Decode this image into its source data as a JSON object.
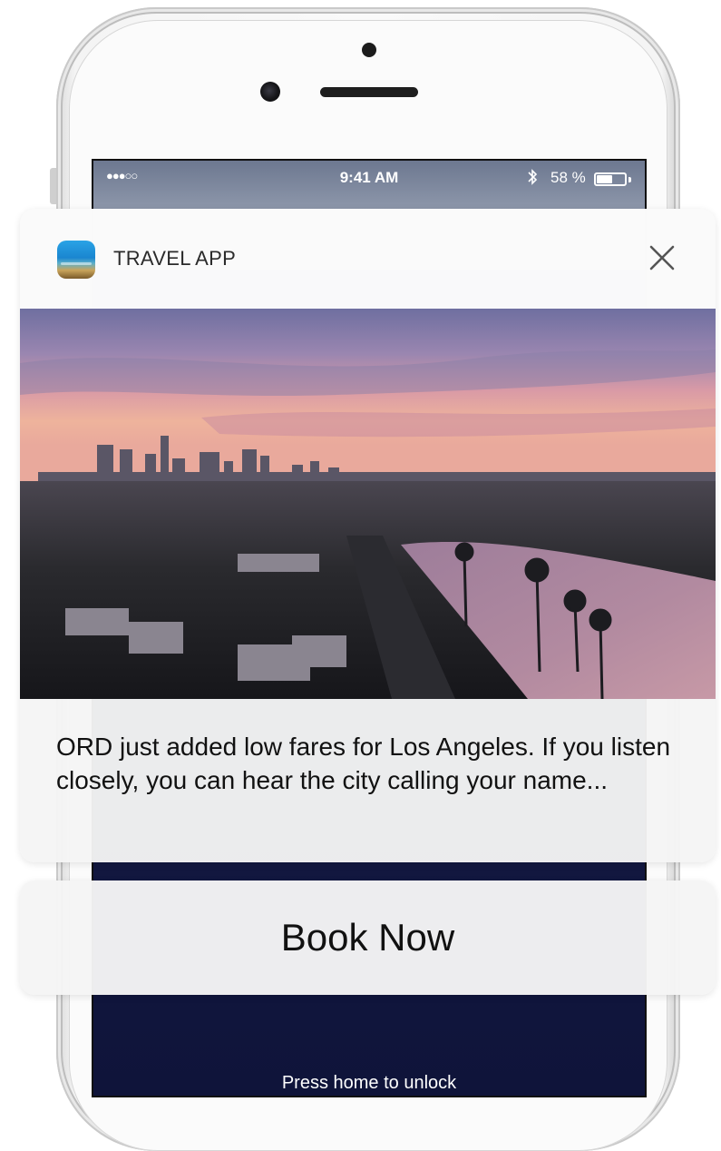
{
  "status_bar": {
    "signal": "●●●○○",
    "time": "9:41 AM",
    "bluetooth": "bluetooth-icon",
    "battery_percent": "58 %",
    "battery_level": 0.58
  },
  "notification": {
    "app_name": "TRAVEL APP",
    "app_icon": "travel-app-icon",
    "close_icon": "close-icon",
    "image": "los-angeles-sunset-skyline-photo",
    "message": "ORD just added low fares for Los Angeles. If you listen closely, you can hear the city calling your name..."
  },
  "action": {
    "label": "Book Now"
  },
  "lock_screen": {
    "unlock_hint": "Press home to unlock"
  },
  "colors": {
    "card_background": "#f5f5f5",
    "wallpaper_dark": "#151b45",
    "sky_pink": "#e8a7a4",
    "sky_purple": "#7a7aa8"
  }
}
